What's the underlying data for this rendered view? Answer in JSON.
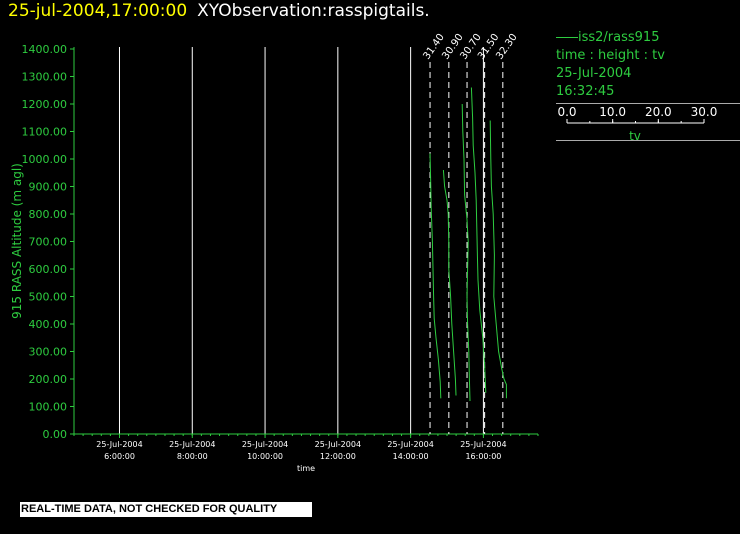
{
  "header": {
    "datetime": "25-jul-2004,17:00:00",
    "observation": "XYObservation:rasspigtails."
  },
  "legend": {
    "series": "iss2/rass915",
    "variables": "time : height : tv",
    "date": "25-Jul-2004",
    "time": "16:32:45",
    "scale_ticks": [
      "0.0",
      "10.0",
      "20.0",
      "30.0"
    ],
    "scale_label": "tv"
  },
  "banner": "REAL-TIME DATA, NOT CHECKED FOR QUALITY",
  "colors": {
    "trace": "#2ecc40",
    "grid": "#ffffff",
    "title": "#ffff00",
    "background": "#000000"
  },
  "chart_data": {
    "type": "line",
    "ylabel": "915 RASS Altitude (m agl)",
    "xlabel": "time",
    "ylim": [
      0,
      1400
    ],
    "yticks": [
      "0.00",
      "100.00",
      "200.00",
      "300.00",
      "400.00",
      "500.00",
      "600.00",
      "700.00",
      "800.00",
      "900.00",
      "1000.00",
      "1100.00",
      "1200.00",
      "1300.00",
      "1400.00"
    ],
    "xlim": [
      "2004-07-25T04:45:00",
      "2004-07-25T17:30:00"
    ],
    "xticks": [
      {
        "t": "2004-07-25T06:00:00",
        "date": "25-Jul-2004",
        "time": "6:00:00"
      },
      {
        "t": "2004-07-25T08:00:00",
        "date": "25-Jul-2004",
        "time": "8:00:00"
      },
      {
        "t": "2004-07-25T10:00:00",
        "date": "25-Jul-2004",
        "time": "10:00:00"
      },
      {
        "t": "2004-07-25T12:00:00",
        "date": "25-Jul-2004",
        "time": "12:00:00"
      },
      {
        "t": "2004-07-25T14:00:00",
        "date": "25-Jul-2004",
        "time": "14:00:00"
      },
      {
        "t": "2004-07-25T16:00:00",
        "date": "25-Jul-2004",
        "time": "16:00:00"
      }
    ],
    "profiles": [
      {
        "label": "31.40",
        "time": "2004-07-25T14:32:00",
        "points": [
          [
            1020,
            0
          ],
          [
            930,
            1
          ],
          [
            820,
            2
          ],
          [
            700,
            4
          ],
          [
            600,
            5
          ],
          [
            500,
            6
          ],
          [
            420,
            7
          ],
          [
            350,
            10
          ],
          [
            270,
            14
          ],
          [
            190,
            17
          ],
          [
            130,
            18
          ]
        ]
      },
      {
        "label": "30.90",
        "time": "2004-07-25T15:03:00",
        "points": [
          [
            960,
            -9
          ],
          [
            900,
            -7
          ],
          [
            850,
            -3
          ],
          [
            800,
            -1
          ],
          [
            700,
            0
          ],
          [
            600,
            0
          ],
          [
            500,
            3
          ],
          [
            400,
            5
          ],
          [
            300,
            8
          ],
          [
            200,
            11
          ],
          [
            140,
            12
          ]
        ]
      },
      {
        "label": "30.70",
        "time": "2004-07-25T15:33:00",
        "points": [
          [
            1200,
            -8
          ],
          [
            1100,
            -7
          ],
          [
            1000,
            -5
          ],
          [
            870,
            -4
          ],
          [
            780,
            0
          ],
          [
            700,
            2
          ],
          [
            600,
            1
          ],
          [
            500,
            0
          ],
          [
            400,
            1
          ],
          [
            300,
            3
          ],
          [
            200,
            4
          ],
          [
            120,
            5
          ]
        ]
      },
      {
        "label": "31.50",
        "time": "2004-07-25T16:02:00",
        "points": [
          [
            1260,
            -22
          ],
          [
            1150,
            -20
          ],
          [
            1050,
            -19
          ],
          [
            950,
            -16
          ],
          [
            850,
            -14
          ],
          [
            750,
            -13
          ],
          [
            650,
            -12
          ],
          [
            560,
            -11
          ],
          [
            450,
            -8
          ],
          [
            350,
            -3
          ],
          [
            250,
            0
          ],
          [
            150,
            2
          ]
        ]
      },
      {
        "label": "32.30",
        "time": "2004-07-25T16:32:00",
        "points": [
          [
            1140,
            -21
          ],
          [
            1000,
            -20
          ],
          [
            900,
            -19
          ],
          [
            800,
            -16
          ],
          [
            650,
            -14
          ],
          [
            500,
            -15
          ],
          [
            400,
            -11
          ],
          [
            300,
            -7
          ],
          [
            240,
            -2
          ],
          [
            200,
            2
          ],
          [
            180,
            6
          ],
          [
            130,
            6
          ]
        ]
      }
    ]
  }
}
